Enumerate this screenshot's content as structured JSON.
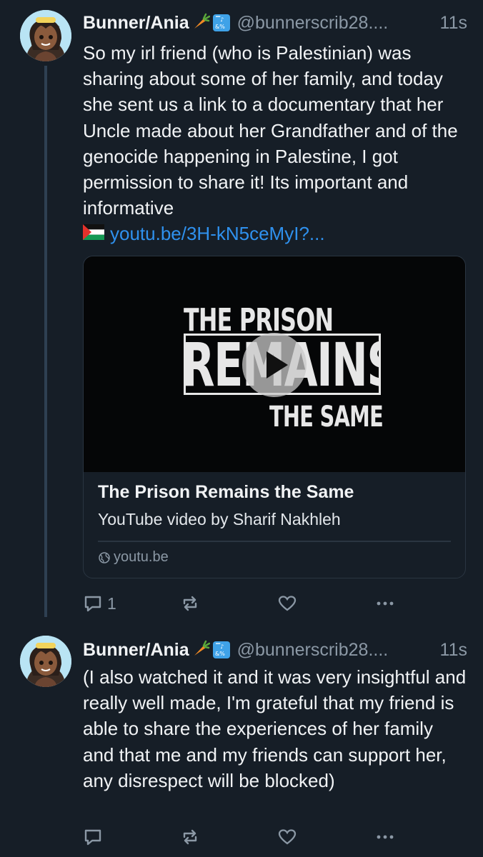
{
  "posts": [
    {
      "author": "Bunner/Ania",
      "handle": "@bunnerscrib28....",
      "time": "11s",
      "text": "So my irl friend (who is Palestinian) was sharing about some of her family, and today she sent us a link to a documentary that her Uncle made about her Grandfather and of the genocide happening in Palestine, I got permission to share it! Its important and informative",
      "link": "youtu.be/3H-kN5ceMyI?...",
      "card": {
        "thumbnail_line1": "THE PRISON",
        "thumbnail_line2": "REMAINS",
        "thumbnail_line3": "THE SAME",
        "title": "The Prison Remains the Same",
        "description": "YouTube video by Sharif Nakhleh",
        "domain": "youtu.be"
      },
      "reply_count": "1"
    },
    {
      "author": "Bunner/Ania",
      "handle": "@bunnerscrib28....",
      "time": "11s",
      "text": "(I also watched it and it was very insightful and really well made, I'm grateful that my friend is able to share the experiences of her family and that me and my friends can support her, any disrespect will be blocked)"
    }
  ],
  "icons": {
    "reply": "reply-icon",
    "repost": "repost-icon",
    "like": "heart-icon",
    "more": "more-icon",
    "globe": "globe-icon",
    "play": "play-icon",
    "flag": "palestine-flag-icon",
    "carrot": "carrot-emoji",
    "symbols": "symbols-emoji"
  },
  "colors": {
    "background": "#161e27",
    "link": "#2f91ee",
    "muted": "#8b98a5",
    "thread_line": "#2e4052"
  }
}
